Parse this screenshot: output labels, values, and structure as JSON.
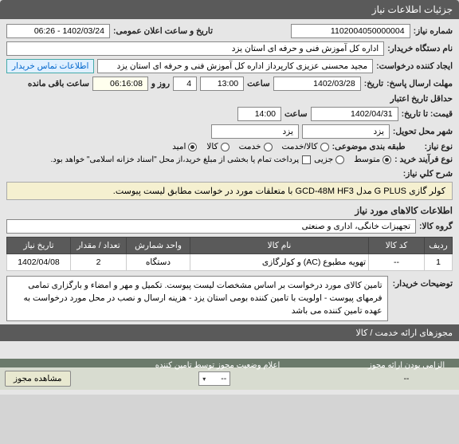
{
  "header": {
    "title": "جزئیات اطلاعات نیاز"
  },
  "fields": {
    "need_no_label": "شماره نیاز:",
    "need_no": "1102004050000004",
    "announce_label": "تاریخ و ساعت اعلان عمومی:",
    "announce": "1402/03/24 - 06:26",
    "buyer_label": "نام دستگاه خریدار:",
    "buyer": "اداره کل آموزش فنی و حرفه ای استان یزد",
    "requester_label": "ایجاد کننده درخواست:",
    "requester": "مجید محسنی عزیزی کارپرداز اداره کل آموزش فنی و حرفه ای استان یزد",
    "contact_link": "اطلاعات تماس خریدار",
    "deadline_label": "مهلت ارسال پاسخ:",
    "tarikh_label": "تاریخ:",
    "saat_label": "ساعت",
    "deadline_date": "1402/03/28",
    "deadline_time": "13:00",
    "days_label": "روز و",
    "days": "4",
    "remain_time": "06:16:08",
    "remain_label": "ساعت باقی مانده",
    "min_credit_label": "حداقل تاریخ اعتبار",
    "price_until_label": "قیمت: تا تاریخ:",
    "credit_date": "1402/04/31",
    "credit_time": "14:00",
    "city_label": "شهر محل تحویل:",
    "city1": "یزد",
    "city2": "یزد",
    "need_type_label": "نوع نیاز:",
    "grouping_label": "طبقه بندی موضوعی:",
    "opt_goods": "کالا/خدمت",
    "opt_service": "خدمت",
    "opt_goods_only": "کالا",
    "opt_aid": "امید",
    "process_label": "نوع فرآیند خرید :",
    "opt_medium": "متوسط",
    "opt_small": "جزیی",
    "pay_note": "پرداخت تمام یا بخشی از مبلغ خرید،از محل \"اسناد خزانه اسلامی\" خواهد بود.",
    "summary_label": "شرح کلي نياز:",
    "summary": "کولر گازی G PLUS مدل GCD-48M HF3 با متعلقات مورد در خواست مطابق لیست پیوست."
  },
  "goods_section": {
    "title": "اطلاعات کالاهای مورد نیاز",
    "group_label": "گروه کالا:",
    "group": "تجهیزات خانگی، اداری و صنعتی"
  },
  "table": {
    "headers": [
      "ردیف",
      "کد کالا",
      "نام کالا",
      "واحد شمارش",
      "تعداد / مقدار",
      "تاریخ نیاز"
    ],
    "row": [
      "1",
      "--",
      "تهویه مطبوع (AC) و کولرگازی",
      "دستگاه",
      "2",
      "1402/04/08"
    ]
  },
  "desc": {
    "label": "توضیحات خریدار:",
    "text": "تامین کالای مورد درخواست بر اساس مشخصات لیست پیوست. تکمیل و مهر و امضاء و بارگزاری تمامی فرمهای پیوست - اولویت با تامین کننده بومی استان یزد - هزینه ارسال و نصب در محل مورد درخواست به عهده تامین کننده می باشد"
  },
  "permits": {
    "title": "مجوزهای ارائه خدمت / کالا"
  },
  "footer": {
    "col1": "الزامی بودن ارائه مجوز",
    "col2": "اعلام وضعیت مجوز توسط تامین کننده",
    "btn": "مشاهده مجوز",
    "sel": "--",
    "val": "--"
  }
}
